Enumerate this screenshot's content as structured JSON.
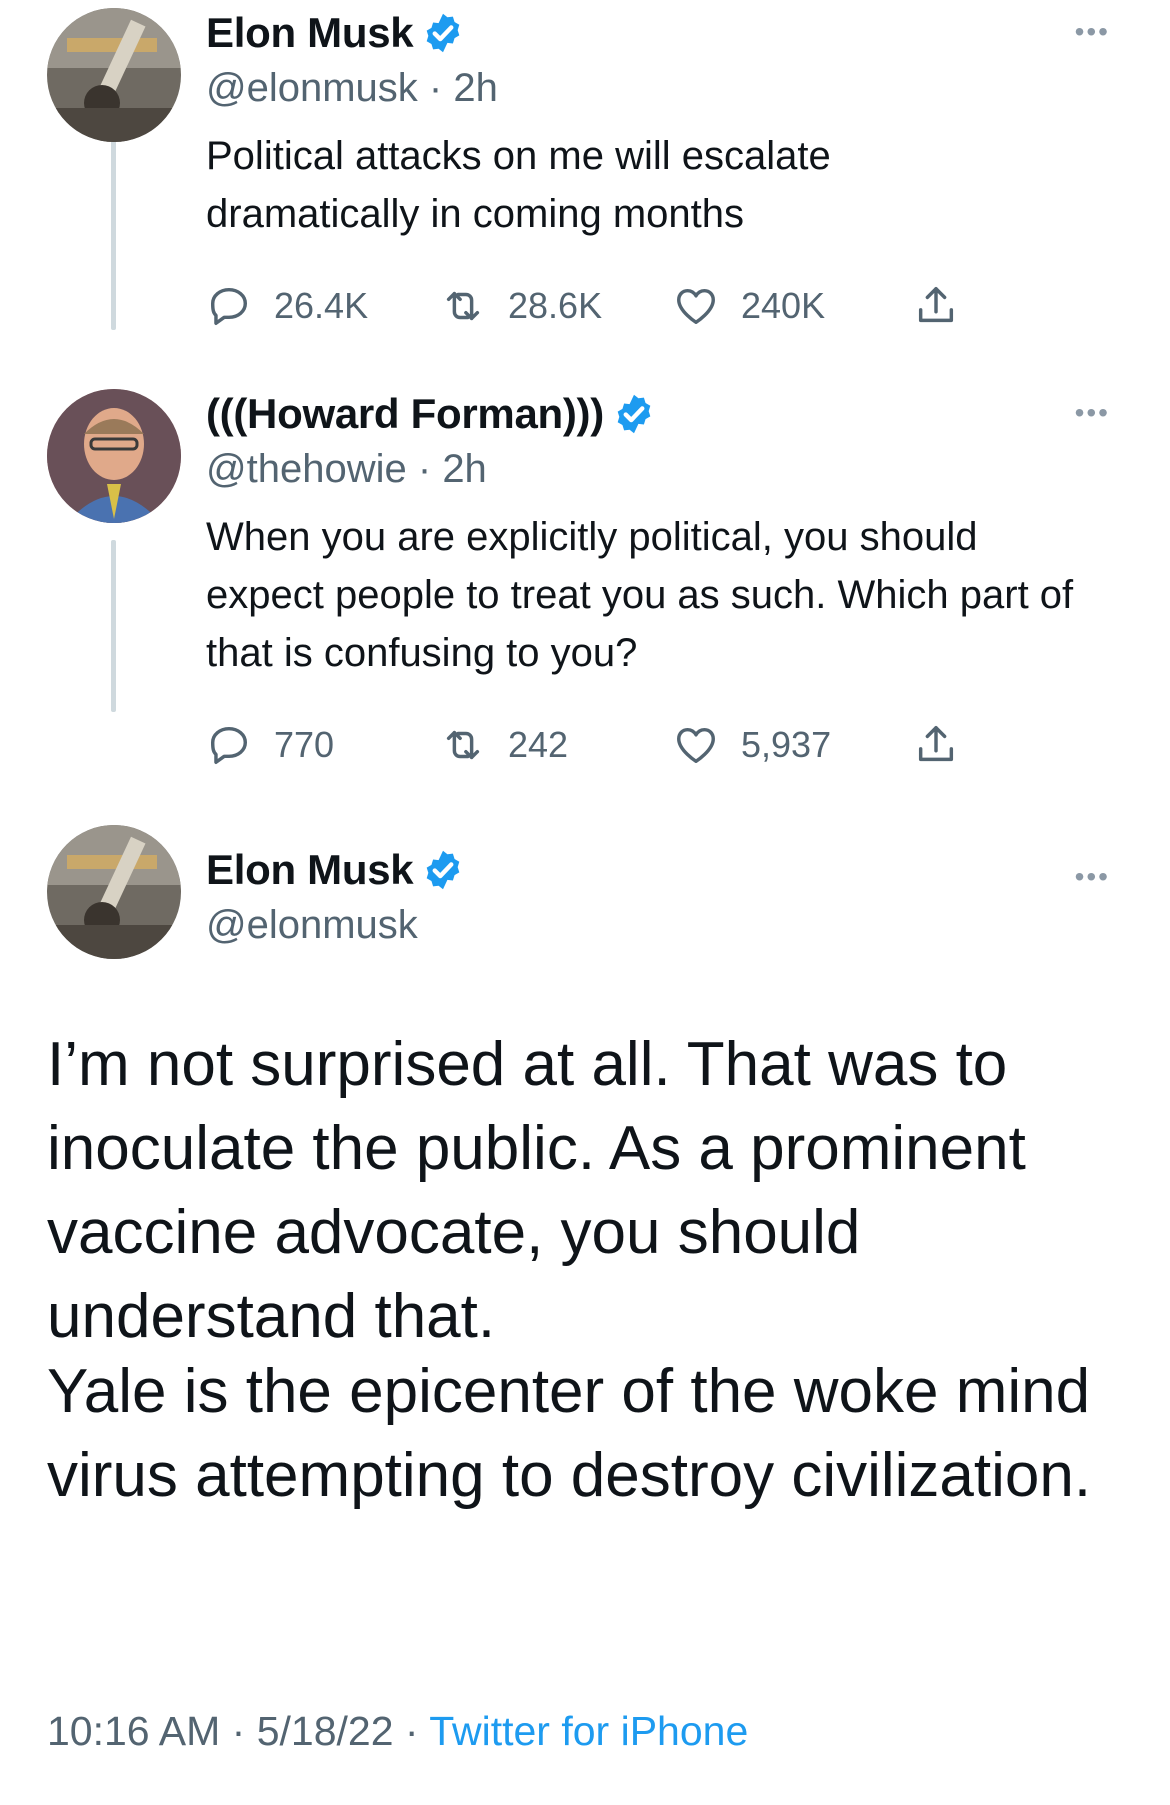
{
  "tweets": [
    {
      "name": "Elon Musk",
      "handle": "@elonmusk",
      "sep": "·",
      "time": "2h",
      "text": "Political attacks on me will escalate dramatically in coming months",
      "replies": "26.4K",
      "retweets": "28.6K",
      "likes": "240K"
    },
    {
      "name": "(((Howard Forman)))",
      "handle": "@thehowie",
      "sep": "·",
      "time": "2h",
      "text": "When you are explicitly political, you should expect people to treat you as such. Which part of that is confusing to you?",
      "replies": "770",
      "retweets": "242",
      "likes": "5,937"
    }
  ],
  "main": {
    "name": "Elon Musk",
    "handle": "@elonmusk",
    "paragraph1": "I’m not surprised at all. That was to inoculate the public. As a prominent vaccine advocate, you should understand that.",
    "paragraph2": "Yale is the epicenter of the woke mind virus attempting to destroy civilization.",
    "time": "10:16 AM",
    "date": "5/18/22",
    "source": "Twitter for iPhone",
    "sep": "·"
  },
  "icons": {
    "verified": "verified-badge-icon",
    "more": "more-dots-icon",
    "reply": "reply-bubble-icon",
    "retweet": "retweet-icon",
    "like": "heart-icon",
    "share": "share-icon"
  },
  "colors": {
    "verified": "#1d9bf0",
    "link": "#1d9bf0",
    "secondary": "#536471"
  }
}
